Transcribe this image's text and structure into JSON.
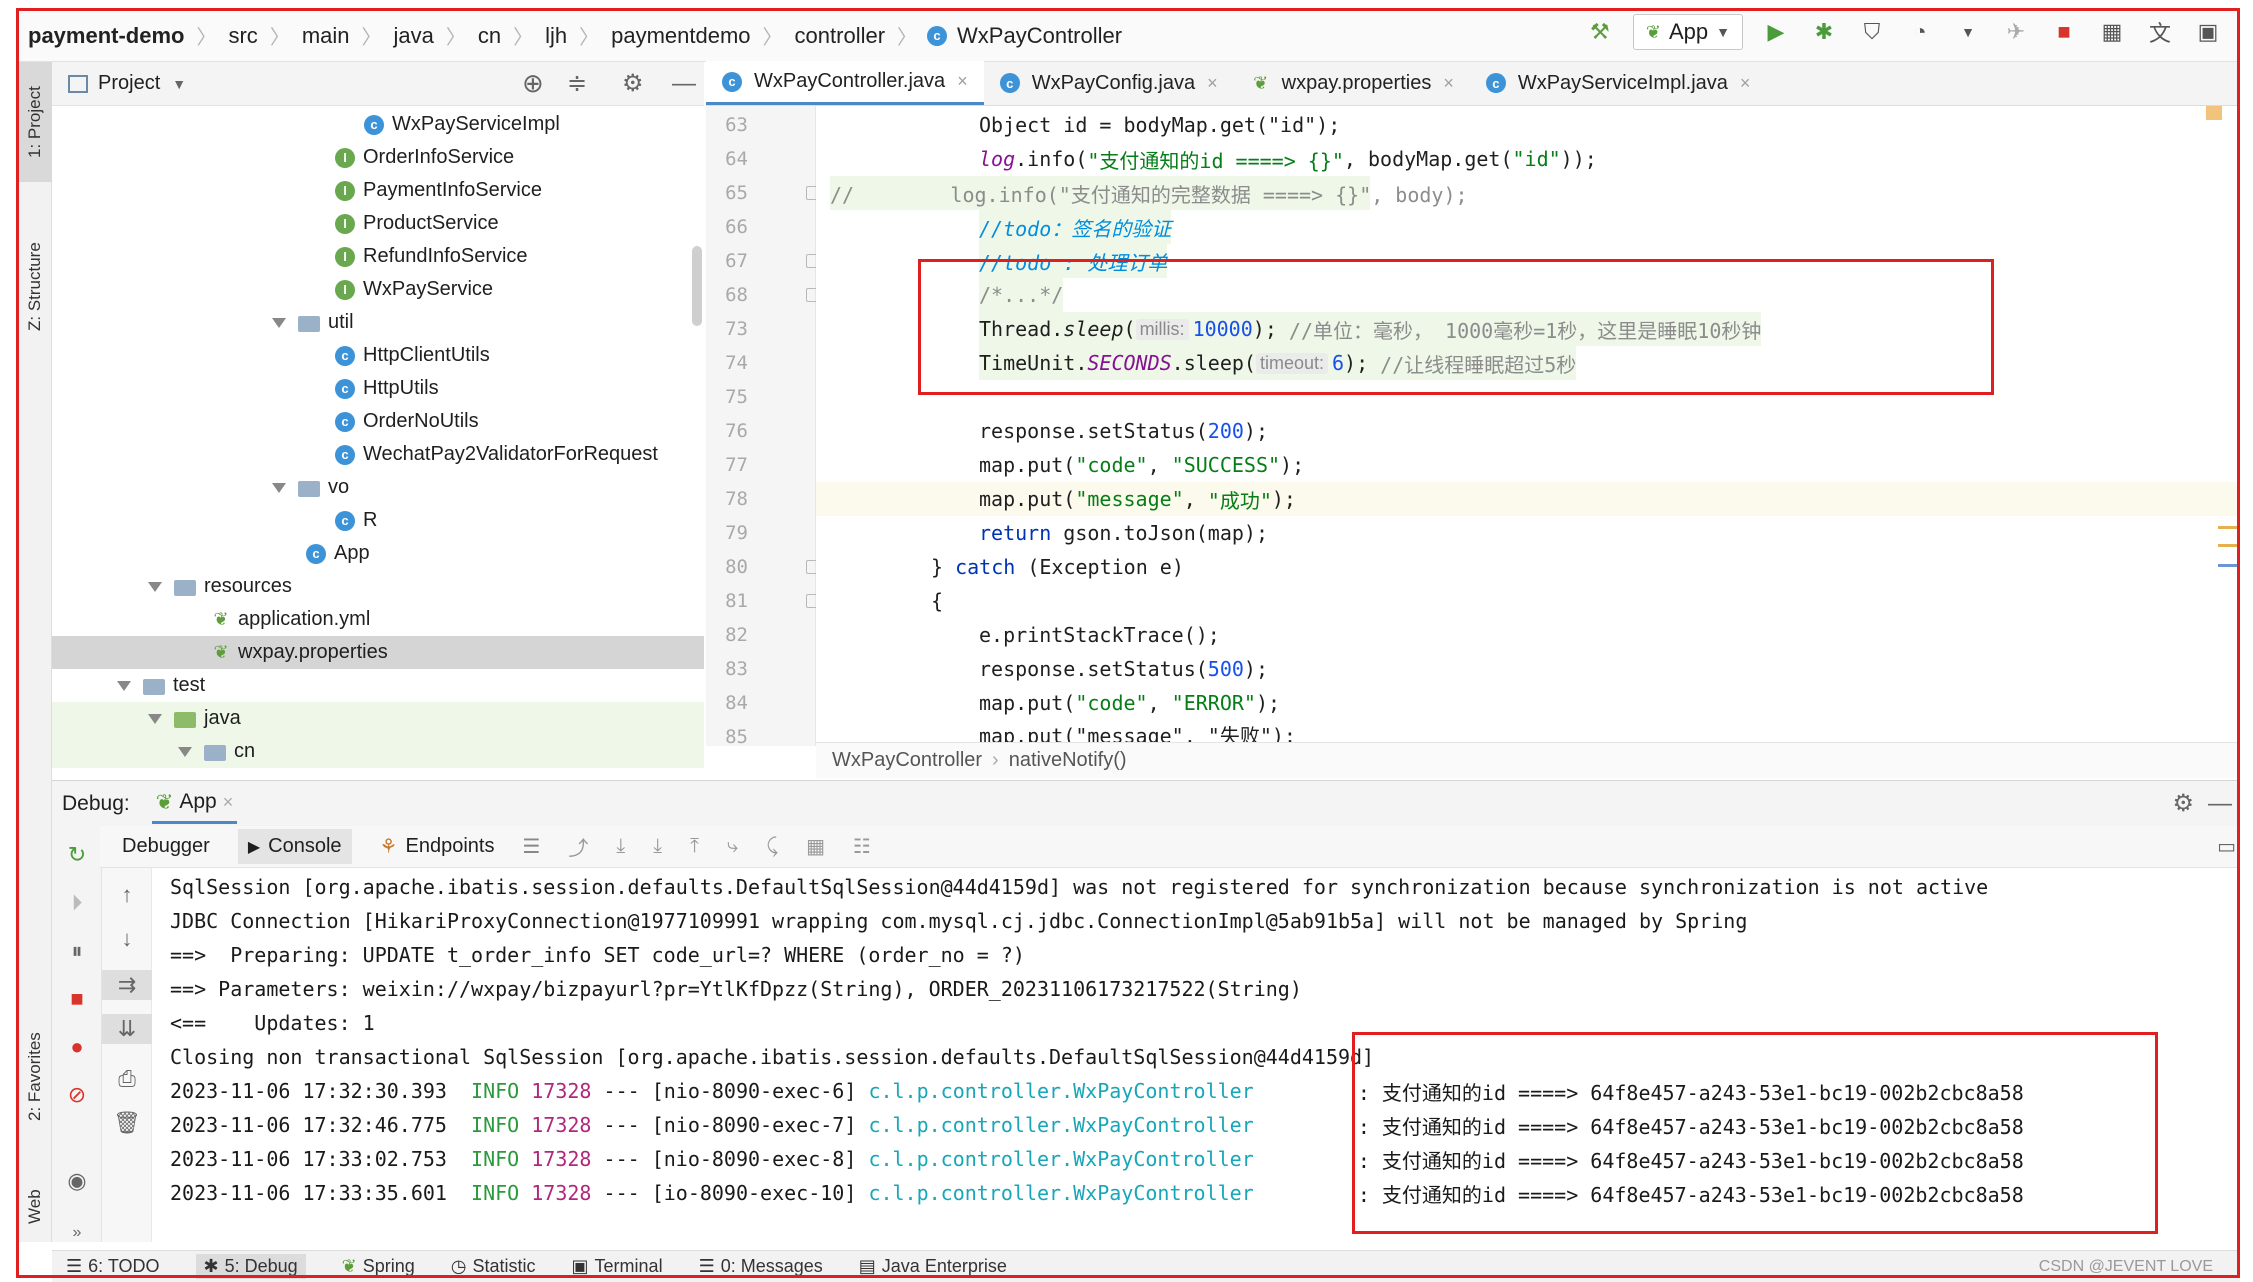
{
  "navbar": {
    "crumbs": [
      "payment-demo",
      "src",
      "main",
      "java",
      "cn",
      "ljh",
      "paymentdemo",
      "controller"
    ],
    "current": "WxPayController",
    "run_config": "App"
  },
  "left_strip": {
    "project": "1: Project",
    "structure": "Z: Structure",
    "favorites": "2: Favorites",
    "web": "Web"
  },
  "project_panel": {
    "title": "Project",
    "tree": [
      {
        "label": "WxPayServiceImpl",
        "kind": "class"
      },
      {
        "label": "OrderInfoService",
        "kind": "iface"
      },
      {
        "label": "PaymentInfoService",
        "kind": "iface"
      },
      {
        "label": "ProductService",
        "kind": "iface"
      },
      {
        "label": "RefundInfoService",
        "kind": "iface"
      },
      {
        "label": "WxPayService",
        "kind": "iface"
      },
      {
        "label": "util",
        "kind": "folder"
      },
      {
        "label": "HttpClientUtils",
        "kind": "class"
      },
      {
        "label": "HttpUtils",
        "kind": "class"
      },
      {
        "label": "OrderNoUtils",
        "kind": "class"
      },
      {
        "label": "WechatPay2ValidatorForRequest",
        "kind": "class"
      },
      {
        "label": "vo",
        "kind": "folder"
      },
      {
        "label": "R",
        "kind": "class"
      },
      {
        "label": "App",
        "kind": "class"
      },
      {
        "label": "resources",
        "kind": "folder"
      },
      {
        "label": "application.yml",
        "kind": "leaf"
      },
      {
        "label": "wxpay.properties",
        "kind": "leaf"
      },
      {
        "label": "test",
        "kind": "folder"
      },
      {
        "label": "java",
        "kind": "folder"
      },
      {
        "label": "cn",
        "kind": "folder"
      }
    ]
  },
  "editor": {
    "tabs": [
      "WxPayController.java",
      "WxPayConfig.java",
      "wxpay.properties",
      "WxPayServiceImpl.java"
    ],
    "line_numbers": [
      "63",
      "64",
      "65",
      "66",
      "67",
      "68",
      "73",
      "74",
      "75",
      "76",
      "77",
      "78",
      "79",
      "80",
      "81",
      "82",
      "83",
      "84",
      "85"
    ],
    "code": {
      "l63": "Object id = bodyMap.get(\"id\");",
      "l64_a": "log",
      "l64_b": ".info(",
      "l64_c": "\"支付通知的id ====> {}\"",
      "l64_d": ", bodyMap.get(",
      "l64_e": "\"id\"",
      "l64_f": "));",
      "l65": "//        log.info(\"支付通知的完整数据 ====> {}\", body);",
      "l66": "//todo：签名的验证",
      "l67": "//todo : 处理订单",
      "l68": "/*...*/",
      "l73_a": "Thread.",
      "l73_b": "sleep",
      "l73_c": "(",
      "l73_hint": "millis:",
      "l73_num": "10000",
      "l73_d": "); ",
      "l73_cmt": "//单位：毫秒， 1000毫秒=1秒，这里是睡眠10秒钟",
      "l74_a": "TimeUnit.",
      "l74_b": "SECONDS",
      "l74_c": ".sleep(",
      "l74_hint": "timeout:",
      "l74_num": "6",
      "l74_d": "); ",
      "l74_cmt": "//让线程睡眠超过5秒",
      "l76_a": "response.setStatus(",
      "l76_num": "200",
      "l76_b": ");",
      "l77_a": "map.put(",
      "l77_s1": "\"code\"",
      "l77_b": ", ",
      "l77_s2": "\"SUCCESS\"",
      "l77_c": ");",
      "l78_a": "map.put(",
      "l78_s1": "\"message\"",
      "l78_b": ", ",
      "l78_s2": "\"成功\"",
      "l78_c": ");",
      "l79_kw": "return",
      "l79_b": " gson.toJson(map);",
      "l80_a": "} ",
      "l80_kw": "catch",
      "l80_b": " (Exception e)",
      "l81": "{",
      "l82": "e.printStackTrace();",
      "l83_a": "response.setStatus(",
      "l83_num": "500",
      "l83_b": ");",
      "l84_a": "map.put(",
      "l84_s1": "\"code\"",
      "l84_b": ", ",
      "l84_s2": "\"ERROR\"",
      "l84_c": ");",
      "l85": "map.put(\"message\", \"失败\");"
    },
    "breadcrumb": [
      "WxPayController",
      "nativeNotify()"
    ]
  },
  "debug": {
    "label": "Debug:",
    "config": "App",
    "tabs": [
      "Debugger",
      "Console",
      "Endpoints"
    ],
    "console_lines": [
      "SqlSession [org.apache.ibatis.session.defaults.DefaultSqlSession@44d4159d] was not registered for synchronization because synchronization is not active",
      "JDBC Connection [HikariProxyConnection@1977109991 wrapping com.mysql.cj.jdbc.ConnectionImpl@5ab91b5a] will not be managed by Spring",
      "==>  Preparing: UPDATE t_order_info SET code_url=? WHERE (order_no = ?)",
      "==> Parameters: weixin://wxpay/bizpayurl?pr=YtlKfDpzz(String), ORDER_20231106173217522(String)",
      "<==    Updates: 1",
      "Closing non transactional SqlSession [org.apache.ibatis.session.defaults.DefaultSqlSession@44d4159d]"
    ],
    "log_rows": [
      {
        "time": "2023-11-06 17:32:30.393",
        "level": "INFO",
        "pid": "17328",
        "thread": " --- [nio-8090-exec-6] ",
        "logger": "c.l.p.controller.WxPayController",
        "msg": "  : 支付通知的id ====> 64f8e457-a243-53e1-bc19-002b2cbc8a58"
      },
      {
        "time": "2023-11-06 17:32:46.775",
        "level": "INFO",
        "pid": "17328",
        "thread": " --- [nio-8090-exec-7] ",
        "logger": "c.l.p.controller.WxPayController",
        "msg": "  : 支付通知的id ====> 64f8e457-a243-53e1-bc19-002b2cbc8a58"
      },
      {
        "time": "2023-11-06 17:33:02.753",
        "level": "INFO",
        "pid": "17328",
        "thread": " --- [nio-8090-exec-8] ",
        "logger": "c.l.p.controller.WxPayController",
        "msg": "  : 支付通知的id ====> 64f8e457-a243-53e1-bc19-002b2cbc8a58"
      },
      {
        "time": "2023-11-06 17:33:35.601",
        "level": "INFO",
        "pid": "17328",
        "thread": " --- [io-8090-exec-10] ",
        "logger": "c.l.p.controller.WxPayController",
        "msg": "  : 支付通知的id ====> 64f8e457-a243-53e1-bc19-002b2cbc8a58"
      }
    ]
  },
  "bottom_bar": [
    "6: TODO",
    "5: Debug",
    "Spring",
    "Statistic",
    "Terminal",
    "0: Messages",
    "Java Enterprise"
  ],
  "watermark": "CSDN @JEVENT LOVE",
  "colors": {
    "annotation_red": "#e02020",
    "keyword": "#0033b3",
    "string": "#067d17",
    "number": "#1750eb",
    "info_green": "#2b9a3c",
    "logger_cyan": "#18a6b8"
  }
}
